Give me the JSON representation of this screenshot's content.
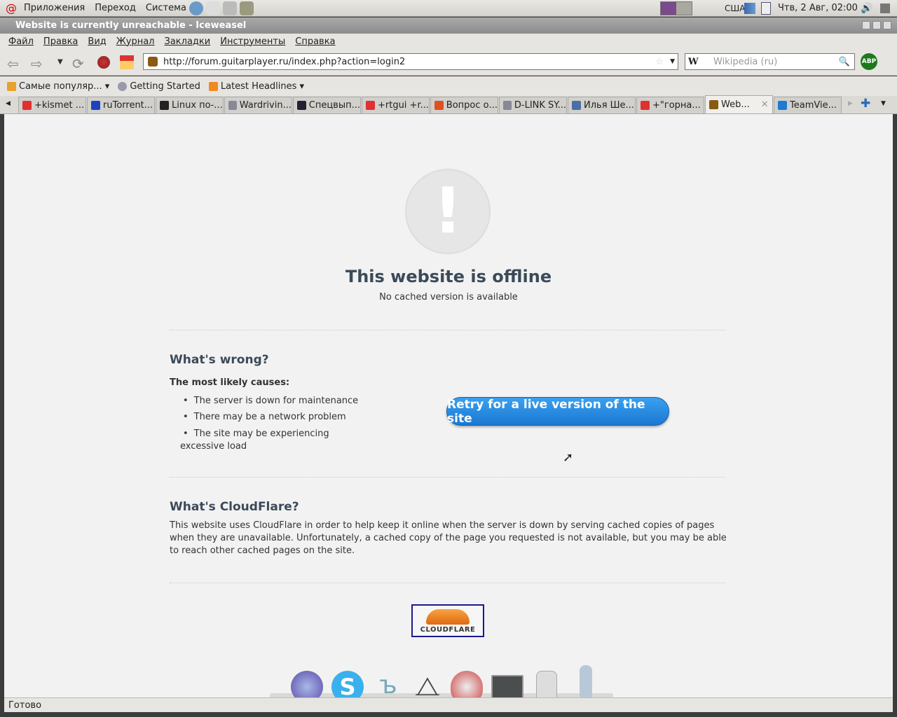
{
  "panel": {
    "menus": [
      "Приложения",
      "Переход",
      "Система"
    ],
    "keyboard": "США",
    "clock": "Чтв,  2 Авг, 02:00"
  },
  "window": {
    "title": "Website is currently unreachable - Iceweasel"
  },
  "menu": [
    "Файл",
    "Правка",
    "Вид",
    "Журнал",
    "Закладки",
    "Инструменты",
    "Справка"
  ],
  "nav": {
    "url": "http://forum.guitarplayer.ru/index.php?action=login2",
    "search_placeholder": "Wikipedia (ru)",
    "search_engine": "W",
    "abp": "ABP"
  },
  "bookmarks": [
    "Самые популяр...",
    "Getting Started",
    "Latest Headlines"
  ],
  "tabs": [
    {
      "label": "+kismet ...",
      "color": "#e03030"
    },
    {
      "label": "ruTorrent...",
      "color": "#2040c0"
    },
    {
      "label": "Linux по-...",
      "color": "#222"
    },
    {
      "label": "Wardrivin...",
      "color": "#889"
    },
    {
      "label": "Спецвып...",
      "color": "#223"
    },
    {
      "label": "+rtgui +r...",
      "color": "#e03030"
    },
    {
      "label": "Вопрос о...",
      "color": "#e05020"
    },
    {
      "label": "D-LINK SY...",
      "color": "#889"
    },
    {
      "label": "Илья Ше...",
      "color": "#4a6fa5"
    },
    {
      "label": "+\"горна...",
      "color": "#e03030"
    },
    {
      "label": "Web...",
      "color": "#8a5a10",
      "active": true
    },
    {
      "label": "TeamVie...",
      "color": "#1e7ad2"
    }
  ],
  "page": {
    "title": "This website is offline",
    "subtitle": "No cached version is available",
    "wrong_heading": "What's wrong?",
    "causes_label": "The most likely causes:",
    "causes": [
      "The server is down for maintenance",
      "There may be a network problem",
      "The site may be experiencing excessive load"
    ],
    "retry": "Retry for a live version of the site",
    "cf_heading": "What's CloudFlare?",
    "cf_text": "This website uses CloudFlare in order to help keep it online when the server is down by serving cached copies of pages when they are unavailable. Unfortunately, a cached copy of the page you requested is not available, but you may be able to reach other cached pages on the site.",
    "logo": "CLOUDFLARE"
  },
  "status": "Готово"
}
